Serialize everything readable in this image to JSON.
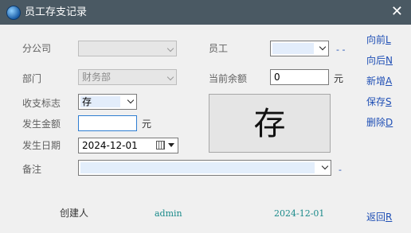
{
  "window": {
    "title": "员工存支记录",
    "close_icon": "close-icon"
  },
  "form": {
    "branch": {
      "label": "分公司",
      "value": ""
    },
    "employee": {
      "label": "员工",
      "value": ""
    },
    "department": {
      "label": "部门",
      "value": "财务部"
    },
    "balance": {
      "label": "当前余额",
      "value": "0",
      "unit": "元"
    },
    "flag": {
      "label": "收支标志",
      "value": "存"
    },
    "amount": {
      "label": "发生金额",
      "value": "",
      "unit": "元"
    },
    "date": {
      "label": "发生日期",
      "value": "2024-12-01"
    },
    "remark": {
      "label": "备注",
      "value": ""
    },
    "big_flag": "存"
  },
  "actions": {
    "prev": {
      "label": "向前",
      "key": "L"
    },
    "next": {
      "label": "向后",
      "key": "N"
    },
    "add": {
      "label": "新增",
      "key": "A"
    },
    "save": {
      "label": "保存",
      "key": "S"
    },
    "delete": {
      "label": "删除",
      "key": "D"
    },
    "back": {
      "label": "返回",
      "key": "R"
    }
  },
  "footer": {
    "creator_label": "创建人",
    "creator": "admin",
    "created_date": "2024-12-01"
  },
  "colors": {
    "titlebar": "#4a5963",
    "link": "#1f4fb5",
    "footer_value": "#1a8a8a"
  }
}
